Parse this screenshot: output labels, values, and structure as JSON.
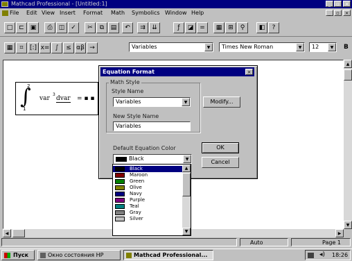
{
  "window": {
    "title": "Mathcad Professional - [Untitled:1]",
    "controls": [
      "_",
      "▫",
      "×"
    ]
  },
  "menu": [
    "File",
    "Edit",
    "View",
    "Insert",
    "Format",
    "Math",
    "Symbolics",
    "Window",
    "Help"
  ],
  "toolbar2": {
    "style_value": "Variables",
    "font_value": "Times New Roman",
    "size_value": "12"
  },
  "worksheet": {
    "integral_upper": "2",
    "integral_lower": "1",
    "integral_body": "var",
    "integral_exp": "3",
    "integral_diff": "dvar",
    "integral_result": "= ▪ ▪"
  },
  "dialog": {
    "title": "Equation Format",
    "group_label": "Math Style",
    "style_name_label": "Style Name",
    "style_name_value": "Variables",
    "modify_button": "Modify...",
    "new_style_label": "New Style Name",
    "new_style_value": "Variables",
    "color_label": "Default Equation Color",
    "color_value": "Black",
    "ok_button": "OK",
    "cancel_button": "Cancel",
    "close_icon": "×"
  },
  "color_options": [
    {
      "name": "Black",
      "color": "#000000"
    },
    {
      "name": "Maroon",
      "color": "#800000"
    },
    {
      "name": "Green",
      "color": "#008000"
    },
    {
      "name": "Olive",
      "color": "#808000"
    },
    {
      "name": "Navy",
      "color": "#000080"
    },
    {
      "name": "Purple",
      "color": "#800080"
    },
    {
      "name": "Teal",
      "color": "#008080"
    },
    {
      "name": "Gray",
      "color": "#808080"
    },
    {
      "name": "Silver",
      "color": "#c0c0c0"
    }
  ],
  "statusbar": {
    "mode": "Auto",
    "page": "Page 1"
  },
  "taskbar": {
    "start": "Пуск",
    "task1": "Окно состояния HP",
    "task2": "Mathcad Professional...",
    "clock": "18:26"
  }
}
